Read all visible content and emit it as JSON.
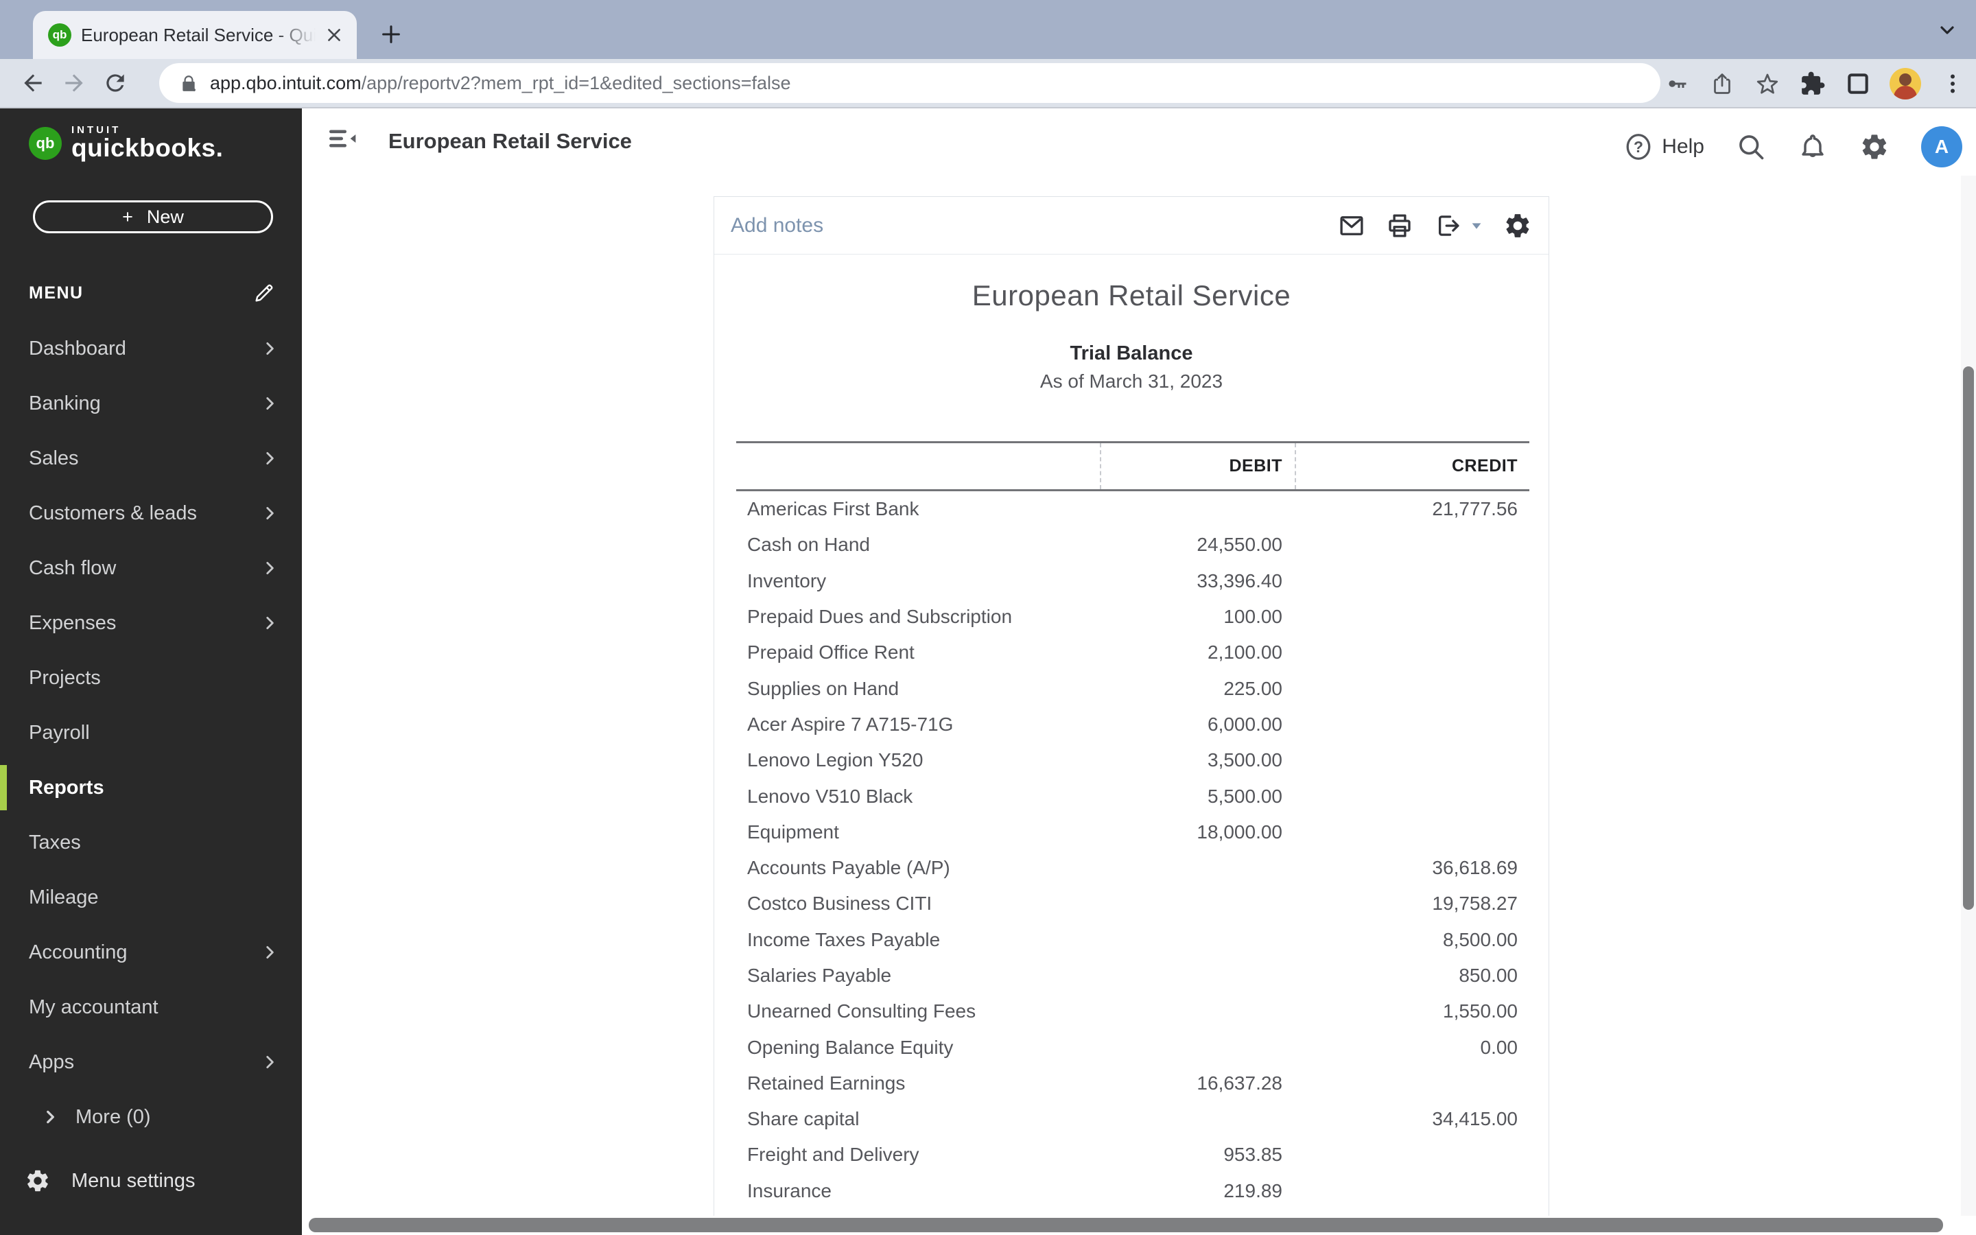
{
  "browser": {
    "tab_title": "European Retail Service - Quic",
    "url_host": "app.qbo.intuit.com",
    "url_path": "/app/reportv2?mem_rpt_id=1&edited_sections=false"
  },
  "sidebar": {
    "brand": {
      "monogram": "qb",
      "intuit": "INTUIT",
      "name": "quickbooks."
    },
    "new_button": {
      "plus": "+",
      "label": "New"
    },
    "menu_label": "MENU",
    "items": [
      {
        "label": "Dashboard",
        "chevron": true
      },
      {
        "label": "Banking",
        "chevron": true
      },
      {
        "label": "Sales",
        "chevron": true
      },
      {
        "label": "Customers & leads",
        "chevron": true
      },
      {
        "label": "Cash flow",
        "chevron": true
      },
      {
        "label": "Expenses",
        "chevron": true
      },
      {
        "label": "Projects"
      },
      {
        "label": "Payroll"
      },
      {
        "label": "Reports",
        "active": true
      },
      {
        "label": "Taxes"
      },
      {
        "label": "Mileage"
      },
      {
        "label": "Accounting",
        "chevron": true
      },
      {
        "label": "My accountant"
      },
      {
        "label": "Apps",
        "chevron": true
      },
      {
        "label": "More (0)",
        "indent": true,
        "lead_chevron": true
      }
    ],
    "menu_settings": "Menu settings"
  },
  "header": {
    "company": "European Retail Service",
    "help": "Help",
    "avatar_initial": "A"
  },
  "report": {
    "add_notes": "Add notes",
    "company": "European Retail Service",
    "title": "Trial Balance",
    "subtitle": "As of March 31, 2023",
    "columns": {
      "debit": "DEBIT",
      "credit": "CREDIT"
    },
    "rows": [
      {
        "name": "Americas First Bank",
        "debit": "",
        "credit": "21,777.56"
      },
      {
        "name": "Cash on Hand",
        "debit": "24,550.00",
        "credit": ""
      },
      {
        "name": "Inventory",
        "debit": "33,396.40",
        "credit": ""
      },
      {
        "name": "Prepaid Dues and Subscription",
        "debit": "100.00",
        "credit": ""
      },
      {
        "name": "Prepaid Office Rent",
        "debit": "2,100.00",
        "credit": ""
      },
      {
        "name": "Supplies on Hand",
        "debit": "225.00",
        "credit": ""
      },
      {
        "name": "Acer Aspire 7 A715-71G",
        "debit": "6,000.00",
        "credit": ""
      },
      {
        "name": "Lenovo Legion Y520",
        "debit": "3,500.00",
        "credit": ""
      },
      {
        "name": "Lenovo V510 Black",
        "debit": "5,500.00",
        "credit": ""
      },
      {
        "name": "Equipment",
        "debit": "18,000.00",
        "credit": ""
      },
      {
        "name": "Accounts Payable (A/P)",
        "debit": "",
        "credit": "36,618.69"
      },
      {
        "name": "Costco Business CITI",
        "debit": "",
        "credit": "19,758.27"
      },
      {
        "name": "Income Taxes Payable",
        "debit": "",
        "credit": "8,500.00"
      },
      {
        "name": "Salaries Payable",
        "debit": "",
        "credit": "850.00"
      },
      {
        "name": "Unearned Consulting Fees",
        "debit": "",
        "credit": "1,550.00"
      },
      {
        "name": "Opening Balance Equity",
        "debit": "",
        "credit": "0.00"
      },
      {
        "name": "Retained Earnings",
        "debit": "16,637.28",
        "credit": ""
      },
      {
        "name": "Share capital",
        "debit": "",
        "credit": "34,415.00"
      },
      {
        "name": "Freight and Delivery",
        "debit": "953.85",
        "credit": ""
      },
      {
        "name": "Insurance",
        "debit": "219.89",
        "credit": ""
      }
    ]
  },
  "colors": {
    "qb_green": "#2ca01c",
    "active_lime": "#a7cf4a",
    "sidebar_bg": "#292929",
    "avatar_blue": "#3c8ede",
    "add_notes_blue": "#7d93ae",
    "tabstrip_bg": "#a5b1c8",
    "toolbar_bg": "#dde2ea"
  }
}
